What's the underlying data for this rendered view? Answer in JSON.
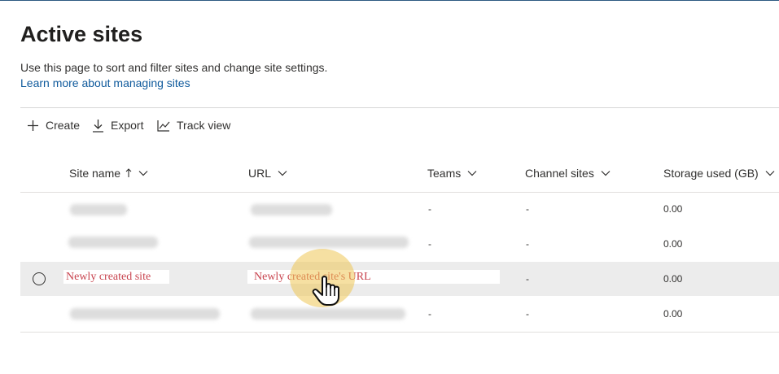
{
  "page": {
    "title": "Active sites",
    "description": "Use this page to sort and filter sites and change site settings.",
    "learn_link": "Learn more about managing sites"
  },
  "commands": {
    "create": "Create",
    "export": "Export",
    "track_view": "Track view"
  },
  "columns": {
    "site_name": "Site name",
    "url": "URL",
    "teams": "Teams",
    "channel_sites": "Channel sites",
    "storage_used": "Storage used (GB)"
  },
  "rows": [
    {
      "site_name": "",
      "url": "",
      "teams": "-",
      "channel_sites": "-",
      "storage": "0.00"
    },
    {
      "site_name": "",
      "url": "",
      "teams": "-",
      "channel_sites": "-",
      "storage": "0.00"
    },
    {
      "site_name": "Newly created site",
      "url": "Newly created site's URL",
      "teams": "",
      "channel_sites": "-",
      "storage": "0.00",
      "selected": true
    },
    {
      "site_name": "",
      "url": "",
      "teams": "-",
      "channel_sites": "-",
      "storage": "0.00"
    }
  ],
  "colors": {
    "accent_link": "#0f5a9c",
    "annotation_red": "#c8434e",
    "pointer_highlight": "#eec756",
    "selected_row": "#ececec"
  },
  "icons": {
    "create": "plus-icon",
    "export": "download-icon",
    "track_view": "trend-line-icon",
    "sort": "sort-ascending-arrow-icon",
    "column_menu": "chevron-down-icon",
    "pointer": "hand-pointer-icon"
  }
}
